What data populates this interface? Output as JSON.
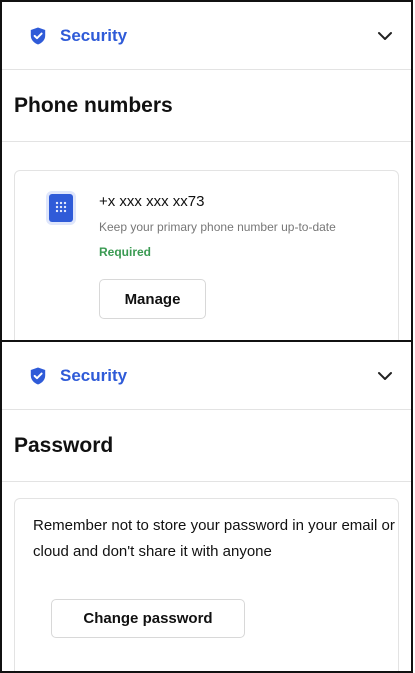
{
  "sections": [
    {
      "header": {
        "label": "Security",
        "icon": "shield-icon",
        "expand_icon": "chevron-down-icon"
      },
      "title": "Phone numbers",
      "phone": {
        "number": "+x xxx xxx xx73",
        "description": "Keep your primary phone number up-to-date",
        "required_label": "Required",
        "manage_label": "Manage",
        "icon": "phone-icon"
      }
    },
    {
      "header": {
        "label": "Security",
        "icon": "shield-icon",
        "expand_icon": "chevron-down-icon"
      },
      "title": "Password",
      "password": {
        "message": "Remember not to store your password in your email or cloud and don't share it with anyone",
        "change_label": "Change password"
      }
    }
  ],
  "colors": {
    "accent": "#2f5bd8",
    "required": "#3a9a52",
    "muted": "#777777",
    "border": "#e3e3e3"
  }
}
